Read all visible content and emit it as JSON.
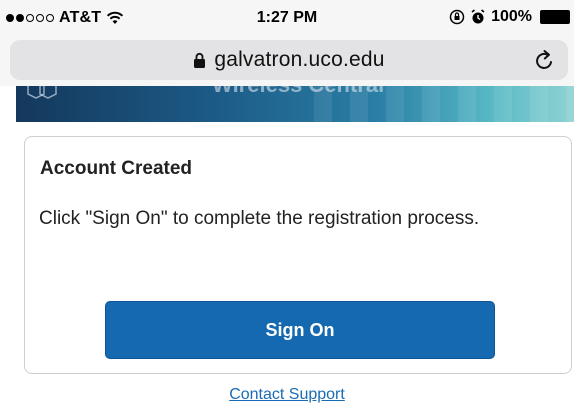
{
  "status_bar": {
    "carrier": "AT&T",
    "time": "1:27 PM",
    "battery": "100%"
  },
  "browser": {
    "url": "galvatron.uco.edu"
  },
  "banner": {
    "title": "Wireless Central"
  },
  "card": {
    "title": "Account Created",
    "message": "Click \"Sign On\" to complete the registration process.",
    "button_label": "Sign On"
  },
  "footer": {
    "contact_link": "Contact Support"
  },
  "colors": {
    "button": "#1569b1",
    "link": "#1a6bb5"
  }
}
